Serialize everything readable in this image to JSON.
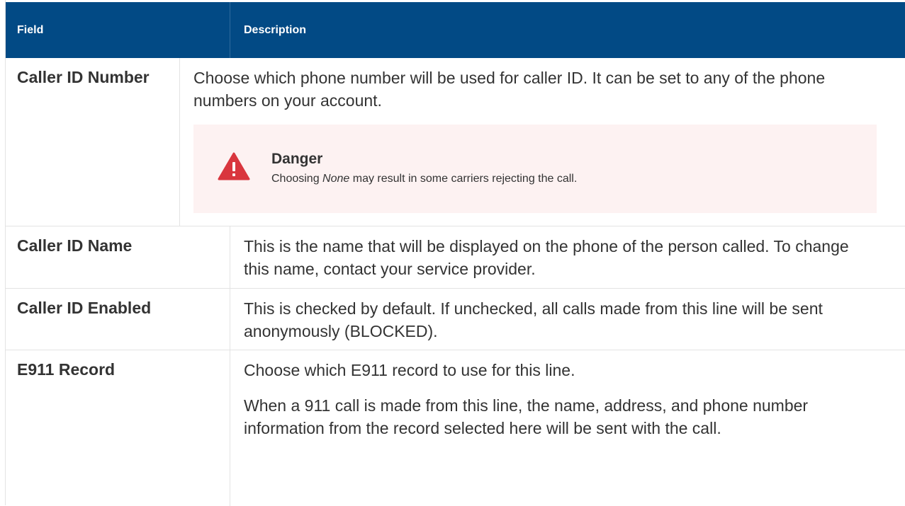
{
  "header": {
    "field": "Field",
    "description": "Description"
  },
  "rows": [
    {
      "field": "Caller ID Number",
      "description": [
        "Choose which phone number will be used for caller ID. It can be set to any of the phone numbers on your account."
      ],
      "alert": {
        "icon": "warning-triangle-icon",
        "title": "Danger",
        "text_before": "Choosing ",
        "text_em": "None",
        "text_after": " may result in some carriers rejecting the call."
      }
    },
    {
      "field": "Caller ID Name",
      "description": [
        "This is the name that will be displayed on the phone of the person called. To change this name, contact your service provider."
      ]
    },
    {
      "field": "Caller ID Enabled",
      "description": [
        "This is checked by default. If unchecked, all calls made from this line will be sent anonymously (BLOCKED)."
      ]
    },
    {
      "field": "E911 Record",
      "description": [
        "Choose which E911 record to use for this line.",
        "When a 911 call is made from this line, the name, address, and phone number information from the record selected here will be sent with the call."
      ]
    }
  ],
  "colors": {
    "header_bg": "#024a85",
    "alert_bg": "#fdf2f2",
    "danger": "#d9363e"
  }
}
